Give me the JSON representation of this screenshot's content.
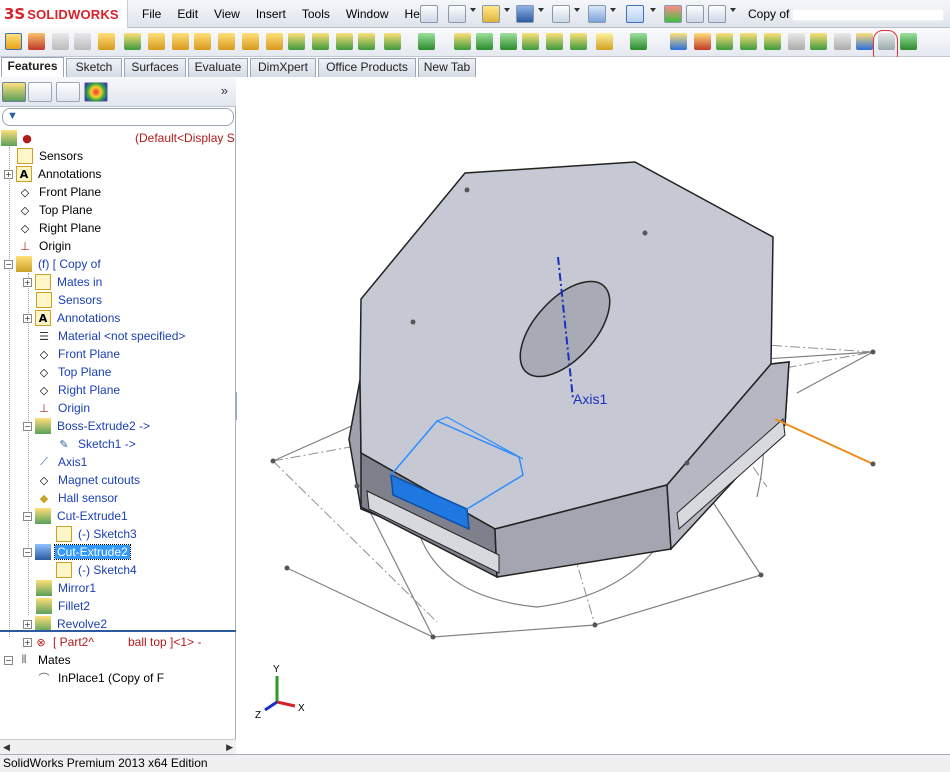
{
  "app": {
    "logo_mark": "3S",
    "logo_text": "SOLIDWORKS",
    "doc_title": "Copy of "
  },
  "menu": [
    "File",
    "Edit",
    "View",
    "Insert",
    "Tools",
    "Window",
    "Help"
  ],
  "tabs": [
    "Features",
    "Sketch",
    "Surfaces",
    "Evaluate",
    "DimXpert",
    "Office Products",
    "New Tab"
  ],
  "active_tab": "Features",
  "panel": {
    "expand_glyph": "»",
    "filter_glyph": "▼"
  },
  "tree": {
    "root": "(Default<Display S",
    "items": [
      {
        "label": "Sensors"
      },
      {
        "label": "Annotations"
      },
      {
        "label": "Front Plane"
      },
      {
        "label": "Top Plane"
      },
      {
        "label": "Right Plane"
      },
      {
        "label": "Origin"
      },
      {
        "label": "(f) [ Copy of"
      },
      {
        "label": "Mates in"
      },
      {
        "label": "Sensors"
      },
      {
        "label": "Annotations"
      },
      {
        "label": "Material <not specified>"
      },
      {
        "label": "Front Plane"
      },
      {
        "label": "Top Plane"
      },
      {
        "label": "Right Plane"
      },
      {
        "label": "Origin"
      },
      {
        "label": "Boss-Extrude2 ->"
      },
      {
        "label": "Sketch1 ->"
      },
      {
        "label": "Axis1"
      },
      {
        "label": "Magnet cutouts"
      },
      {
        "label": "Hall sensor"
      },
      {
        "label": "Cut-Extrude1"
      },
      {
        "label": "(-) Sketch3"
      },
      {
        "label": "Cut-Extrude2"
      },
      {
        "label": "(-) Sketch4"
      },
      {
        "label": "Mirror1"
      },
      {
        "label": "Fillet2"
      },
      {
        "label": "Revolve2"
      },
      {
        "label": "[ Part2^"
      },
      {
        "label": "ball top ]<1> -"
      },
      {
        "label": "Mates"
      },
      {
        "label": "InPlace1 (Copy of F"
      }
    ]
  },
  "viewport": {
    "axis_label": "Axis1",
    "triad": {
      "x": "X",
      "y": "Y",
      "z": "Z"
    }
  },
  "status": "SolidWorks Premium 2013 x64 Edition",
  "colors": {
    "body_fill": "#b9bcc6",
    "top_face": "#c9ccd6",
    "highlight_blue": "#1f78e0",
    "orange_line": "#f08c1a",
    "tree_blue": "#1b3fb5",
    "selection": "#3399ff"
  }
}
